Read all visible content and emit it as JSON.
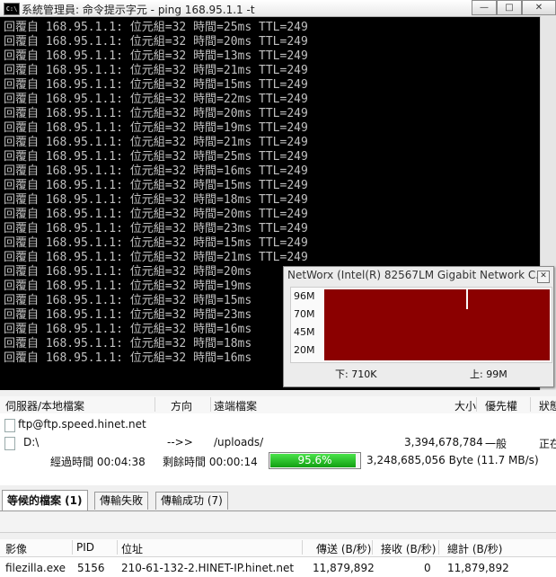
{
  "cmd": {
    "title": "系統管理員: 命令提示字元 - ping  168.95.1.1 -t",
    "icon_text": "C:\\",
    "buttons": [
      "minimize",
      "maximize",
      "close"
    ],
    "lines": [
      "回覆自 168.95.1.1: 位元組=32 時間=25ms TTL=249",
      "回覆自 168.95.1.1: 位元組=32 時間=20ms TTL=249",
      "回覆自 168.95.1.1: 位元組=32 時間=13ms TTL=249",
      "回覆自 168.95.1.1: 位元組=32 時間=21ms TTL=249",
      "回覆自 168.95.1.1: 位元組=32 時間=15ms TTL=249",
      "回覆自 168.95.1.1: 位元組=32 時間=22ms TTL=249",
      "回覆自 168.95.1.1: 位元組=32 時間=20ms TTL=249",
      "回覆自 168.95.1.1: 位元組=32 時間=19ms TTL=249",
      "回覆自 168.95.1.1: 位元組=32 時間=21ms TTL=249",
      "回覆自 168.95.1.1: 位元組=32 時間=25ms TTL=249",
      "回覆自 168.95.1.1: 位元組=32 時間=16ms TTL=249",
      "回覆自 168.95.1.1: 位元組=32 時間=15ms TTL=249",
      "回覆自 168.95.1.1: 位元組=32 時間=18ms TTL=249",
      "回覆自 168.95.1.1: 位元組=32 時間=20ms TTL=249",
      "回覆自 168.95.1.1: 位元組=32 時間=23ms TTL=249",
      "回覆自 168.95.1.1: 位元組=32 時間=15ms TTL=249",
      "回覆自 168.95.1.1: 位元組=32 時間=21ms TTL=249",
      "回覆自 168.95.1.1: 位元組=32 時間=20ms",
      "回覆自 168.95.1.1: 位元組=32 時間=19ms",
      "回覆自 168.95.1.1: 位元組=32 時間=15ms",
      "回覆自 168.95.1.1: 位元組=32 時間=23ms",
      "回覆自 168.95.1.1: 位元組=32 時間=16ms",
      "回覆自 168.95.1.1: 位元組=32 時間=18ms",
      "回覆自 168.95.1.1: 位元組=32 時間=16ms"
    ]
  },
  "networx": {
    "title": "NetWorx (Intel(R) 82567LM Gigabit Network C...",
    "y_ticks": [
      "96M",
      "70M",
      "45M",
      "20M"
    ],
    "download": "下: 710K",
    "upload": "上: 99M",
    "fill_color": "#8b0000"
  },
  "filezilla": {
    "columns": [
      "伺服器/本地檔案",
      "方向",
      "遠端檔案",
      "大小",
      "優先權",
      "狀態"
    ],
    "server": "ftp@ftp.speed.hinet.net",
    "local_path": "D:\\",
    "direction": "-->>",
    "remote_path": "/uploads/",
    "size": "3,394,678,784",
    "priority": "一般",
    "status": "正在",
    "elapsed": "經過時間 00:04:38",
    "remaining": "剩餘時間 00:00:14",
    "progress_text": "95.6%",
    "progress": 0.956,
    "transferred": "3,248,685,056 Byte (11.7 MB/s)",
    "tabs": [
      "等候的檔案 (1)",
      "傳輸失敗",
      "傳輸成功 (7)"
    ]
  },
  "connections": {
    "columns": [
      "影像",
      "PID",
      "位址",
      "傳送 (B/秒)",
      "接收 (B/秒)",
      "總計 (B/秒)"
    ],
    "rows": [
      {
        "image": "filezilla.exe",
        "pid": "5156",
        "address": "210-61-132-2.HINET-IP.hinet.net",
        "sent": "11,879,892",
        "received": "0",
        "total": "11,879,892"
      }
    ]
  }
}
